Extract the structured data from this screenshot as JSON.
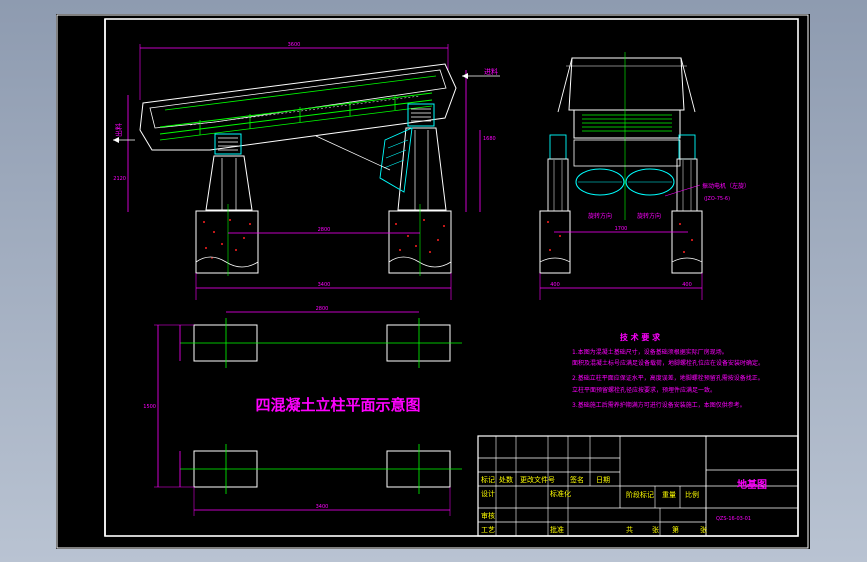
{
  "drawing": {
    "plan_title": "四混凝土立柱平面示意图",
    "labels": {
      "outlet": "出料",
      "inlet": "进料",
      "motor_note": "振动电机（左旋）",
      "motor_model": "(JZO-75-6)",
      "rot_left": "旋转方向",
      "rot_right": "旋转方向"
    },
    "dims": {
      "top_len": "3600",
      "mid_len": "2800",
      "base_len": "3400",
      "plan_top": "2800",
      "plan_bottom": "3400",
      "plan_side": "1500",
      "side_w": "1700",
      "height": "2120",
      "height2": "1680",
      "small_a": "400",
      "small_b": "400"
    },
    "notes": {
      "heading": "技 术 要 求",
      "lines": [
        "1.本图为混凝土基础尺寸，设备基础须根据实际厂房现场。",
        "  面积及混凝土标号应满足设备载荷，地脚螺栓孔位应在设备安装时确定。",
        "2.基础立柱平面应保证水平，高度误差，地脚螺栓预留孔需按设备找正。",
        "  立柱平面预留螺栓孔径应按要求，预埋件应满足一致。",
        "3.基础施工后需养护期满方可进行设备安装施工，本图仅供参考。"
      ]
    },
    "title_block": {
      "row1": [
        "标记",
        "处数",
        "更改文件号",
        "签名",
        "日期"
      ],
      "row2": [
        "设计",
        "",
        "标准化",
        "阶段标记",
        "重量",
        "比例"
      ],
      "row3": [
        "审核",
        "",
        "",
        "",
        "",
        ""
      ],
      "row4": [
        "工艺",
        "",
        "批准",
        "共",
        "张",
        "第",
        "张"
      ],
      "drawing_name": "地基图",
      "drawing_no": "QZS-16-03-01"
    }
  }
}
